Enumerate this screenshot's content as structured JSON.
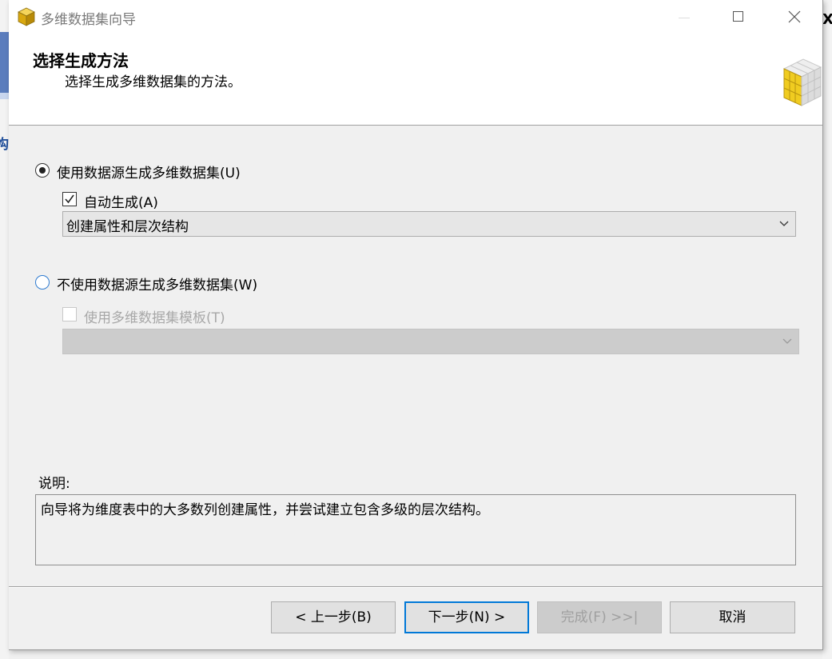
{
  "window": {
    "title": "多维数据集向导"
  },
  "header": {
    "title": "选择生成方法",
    "subtitle": "选择生成多维数据集的方法。"
  },
  "options": {
    "use_source_label": "使用数据源生成多维数据集(U)",
    "auto_generate_label": "自动生成(A)",
    "auto_generate_value": "创建属性和层次结构",
    "no_source_label": "不使用数据源生成多维数据集(W)",
    "use_template_label": "使用多维数据集模板(T)",
    "template_value": ""
  },
  "description": {
    "label": "说明:",
    "text": "向导将为维度表中的大多数列创建属性，并尝试建立包含多级的层次结构。"
  },
  "buttons": {
    "back": "< 上一步(B)",
    "next": "下一步(N) >",
    "finish": "完成(F) >>|",
    "cancel": "取消"
  },
  "background": {
    "left_glyph": "构",
    "right_glyph": "X"
  },
  "state": {
    "use_source_selected": true,
    "auto_generate_checked": true,
    "no_source_selected": false,
    "use_template_checked": false
  },
  "icons": {
    "app": "cube-wizard-icon",
    "header": "cube-grid-icon"
  },
  "colors": {
    "accent": "#0078d7",
    "radio_border": "#2f7bd0",
    "cube_yellow": "#e8c21a"
  }
}
